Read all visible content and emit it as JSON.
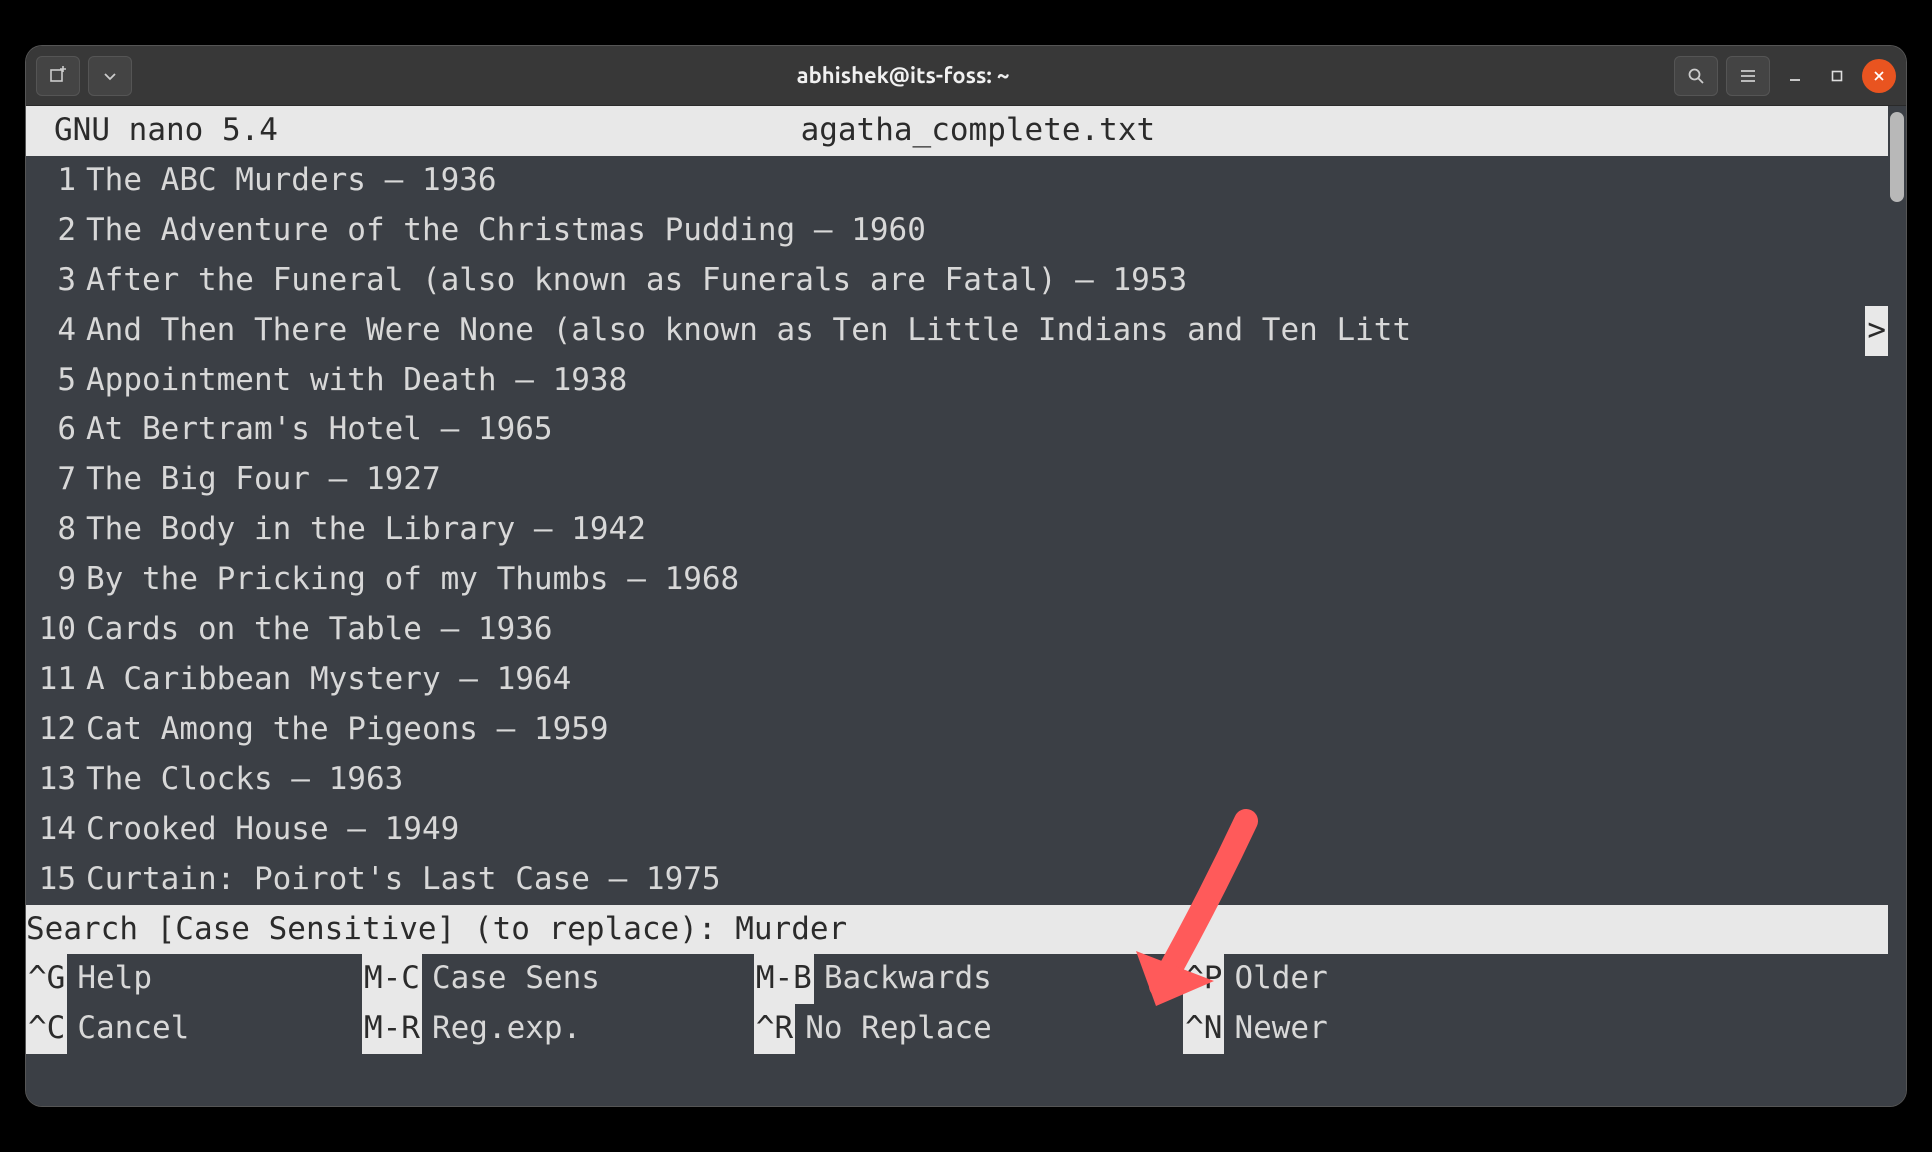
{
  "window": {
    "title": "abhishek@its-foss: ~"
  },
  "nano": {
    "app_name": "GNU nano 5.4",
    "filename": "agatha_complete.txt",
    "lines": [
      {
        "n": "1",
        "text": "The ABC Murders – 1936"
      },
      {
        "n": "2",
        "text": "The Adventure of the Christmas Pudding – 1960"
      },
      {
        "n": "3",
        "text": "After the Funeral (also known as Funerals are Fatal) – 1953"
      },
      {
        "n": "4",
        "text": "And Then There Were None (also known as Ten Little Indians and Ten Litt",
        "overflow": ">"
      },
      {
        "n": "5",
        "text": "Appointment with Death – 1938"
      },
      {
        "n": "6",
        "text": "At Bertram's Hotel – 1965"
      },
      {
        "n": "7",
        "text": "The Big Four – 1927"
      },
      {
        "n": "8",
        "text": "The Body in the Library – 1942"
      },
      {
        "n": "9",
        "text": "By the Pricking of my Thumbs – 1968"
      },
      {
        "n": "10",
        "text": "Cards on the Table – 1936"
      },
      {
        "n": "11",
        "text": "A Caribbean Mystery – 1964"
      },
      {
        "n": "12",
        "text": "Cat Among the Pigeons – 1959"
      },
      {
        "n": "13",
        "text": "The Clocks – 1963"
      },
      {
        "n": "14",
        "text": "Crooked House – 1949"
      },
      {
        "n": "15",
        "text": "Curtain: Poirot's Last Case – 1975"
      }
    ],
    "search": {
      "prompt": "Search [Case Sensitive] (to replace): ",
      "value": "Murder"
    },
    "shortcuts_row1": [
      {
        "key": "^G",
        "label": "Help"
      },
      {
        "key": "M-C",
        "label": "Case Sens"
      },
      {
        "key": "M-B",
        "label": "Backwards"
      },
      {
        "key": "^P",
        "label": "Older"
      }
    ],
    "shortcuts_row2": [
      {
        "key": "^C",
        "label": "Cancel"
      },
      {
        "key": "M-R",
        "label": "Reg.exp."
      },
      {
        "key": "^R",
        "label": "No Replace"
      },
      {
        "key": "^N",
        "label": "Newer"
      }
    ]
  }
}
